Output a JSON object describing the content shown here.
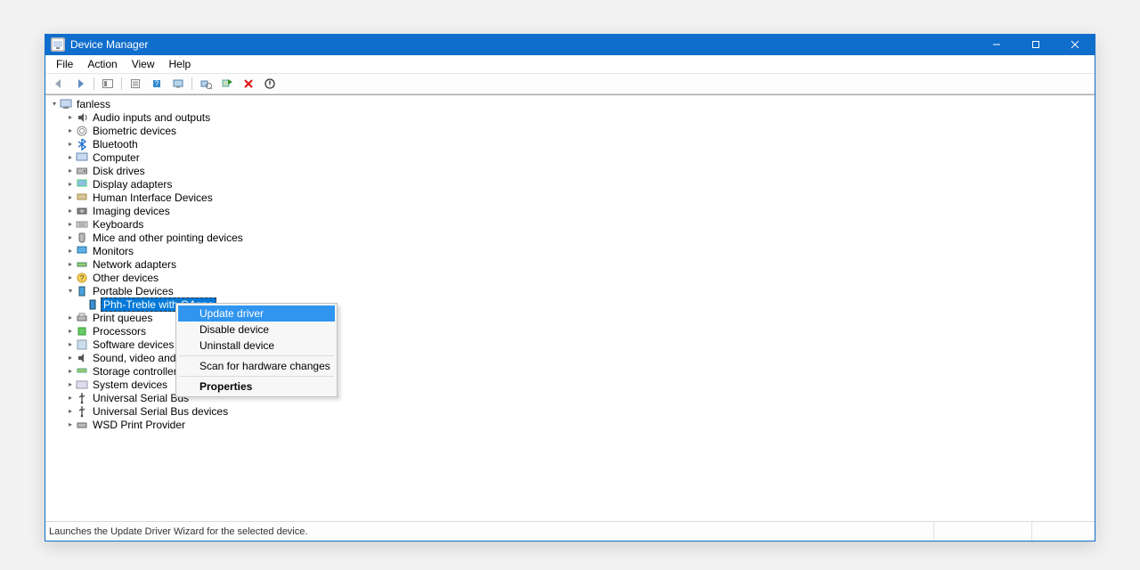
{
  "window": {
    "title": "Device Manager"
  },
  "menu": {
    "file": "File",
    "action": "Action",
    "view": "View",
    "help": "Help"
  },
  "tree": {
    "root": "fanless",
    "categories": [
      "Audio inputs and outputs",
      "Biometric devices",
      "Bluetooth",
      "Computer",
      "Disk drives",
      "Display adapters",
      "Human Interface Devices",
      "Imaging devices",
      "Keyboards",
      "Mice and other pointing devices",
      "Monitors",
      "Network adapters",
      "Other devices",
      "Portable Devices",
      "Print queues",
      "Processors",
      "Software devices",
      "Sound, video and game controllers",
      "Storage controllers",
      "System devices",
      "Universal Serial Bus controllers",
      "Universal Serial Bus devices",
      "WSD Print Provider"
    ],
    "portable_child": "Phh-Treble with GApps"
  },
  "context_menu": {
    "update_driver": "Update driver",
    "disable_device": "Disable device",
    "uninstall_device": "Uninstall device",
    "scan_hw": "Scan for hardware changes",
    "properties": "Properties"
  },
  "status": "Launches the Update Driver Wizard for the selected device."
}
